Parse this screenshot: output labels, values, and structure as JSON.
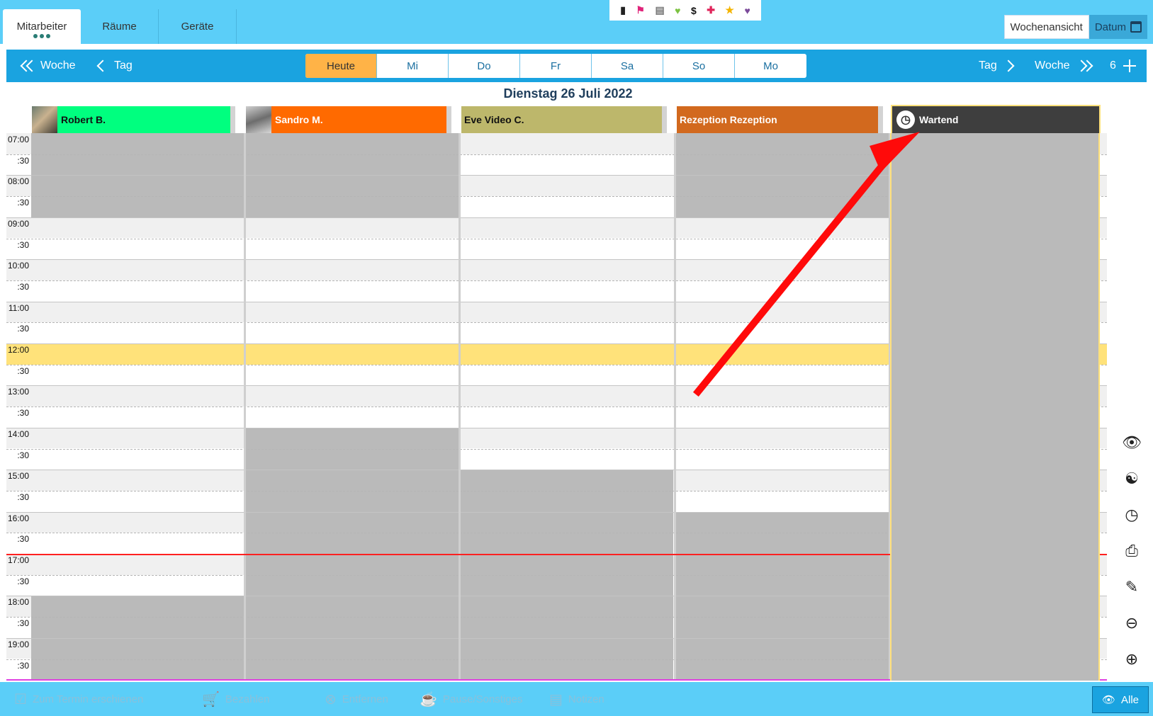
{
  "top_tabs": [
    {
      "label": "Mitarbeiter",
      "active": true
    },
    {
      "label": "Räume",
      "active": false
    },
    {
      "label": "Geräte",
      "active": false
    }
  ],
  "icon_strip": {
    "icons": [
      "clipboard-icon",
      "flag-icon",
      "note-icon",
      "heart-icon",
      "dollar-icon",
      "plus-cross-icon",
      "star-icon",
      "broken-heart-icon"
    ],
    "dollar_symbol": "$"
  },
  "view": {
    "week_label": "Wochenansicht",
    "date_label": "Datum"
  },
  "nav": {
    "prev_week": "Woche",
    "prev_day": "Tag",
    "next_day": "Tag",
    "next_week": "Woche",
    "count": "6",
    "days": [
      "Heute",
      "Mi",
      "Do",
      "Fr",
      "Sa",
      "So",
      "Mo"
    ]
  },
  "date_title": "Dienstag 26 Juli 2022",
  "columns": [
    {
      "name": "Robert B.",
      "color": "#00ff7f",
      "has_avatar": true
    },
    {
      "name": "Sandro M.",
      "color": "#ff6a00",
      "text_color": "#ffffff",
      "has_avatar": true
    },
    {
      "name": "Eve Video C.",
      "color": "#bdb76b",
      "has_avatar": false
    },
    {
      "name": "Rezeption Rezeption",
      "color": "#d2691e",
      "text_color": "#ffffff",
      "has_avatar": false
    },
    {
      "name": "Wartend",
      "color": "#3e3e3e",
      "text_color": "#ffffff",
      "has_avatar": false
    }
  ],
  "times": [
    "07:00",
    ":30",
    "08:00",
    ":30",
    "09:00",
    ":30",
    "10:00",
    ":30",
    "11:00",
    ":30",
    "12:00",
    ":30",
    "13:00",
    ":30",
    "14:00",
    ":30",
    "15:00",
    ":30",
    "16:00",
    ":30",
    "17:00",
    ":30",
    "18:00",
    ":30",
    "19:00",
    ":30"
  ],
  "bottom_actions": [
    {
      "label": "Zum Termin erschienen",
      "icon": "checkbox-icon"
    },
    {
      "label": "Bezahlen",
      "icon": "cart-icon"
    },
    {
      "label": "Entfernen",
      "icon": "remove-icon"
    },
    {
      "label": "Pause/Sonstiges",
      "icon": "coffee-icon"
    },
    {
      "label": "Notizen",
      "icon": "notes-icon"
    }
  ],
  "filter_label": "Alle",
  "side_icons": [
    "eye-slash-icon",
    "group-icon",
    "clock-icon",
    "printer-icon",
    "edit-notes-icon",
    "zoom-out-icon",
    "zoom-in-icon"
  ]
}
